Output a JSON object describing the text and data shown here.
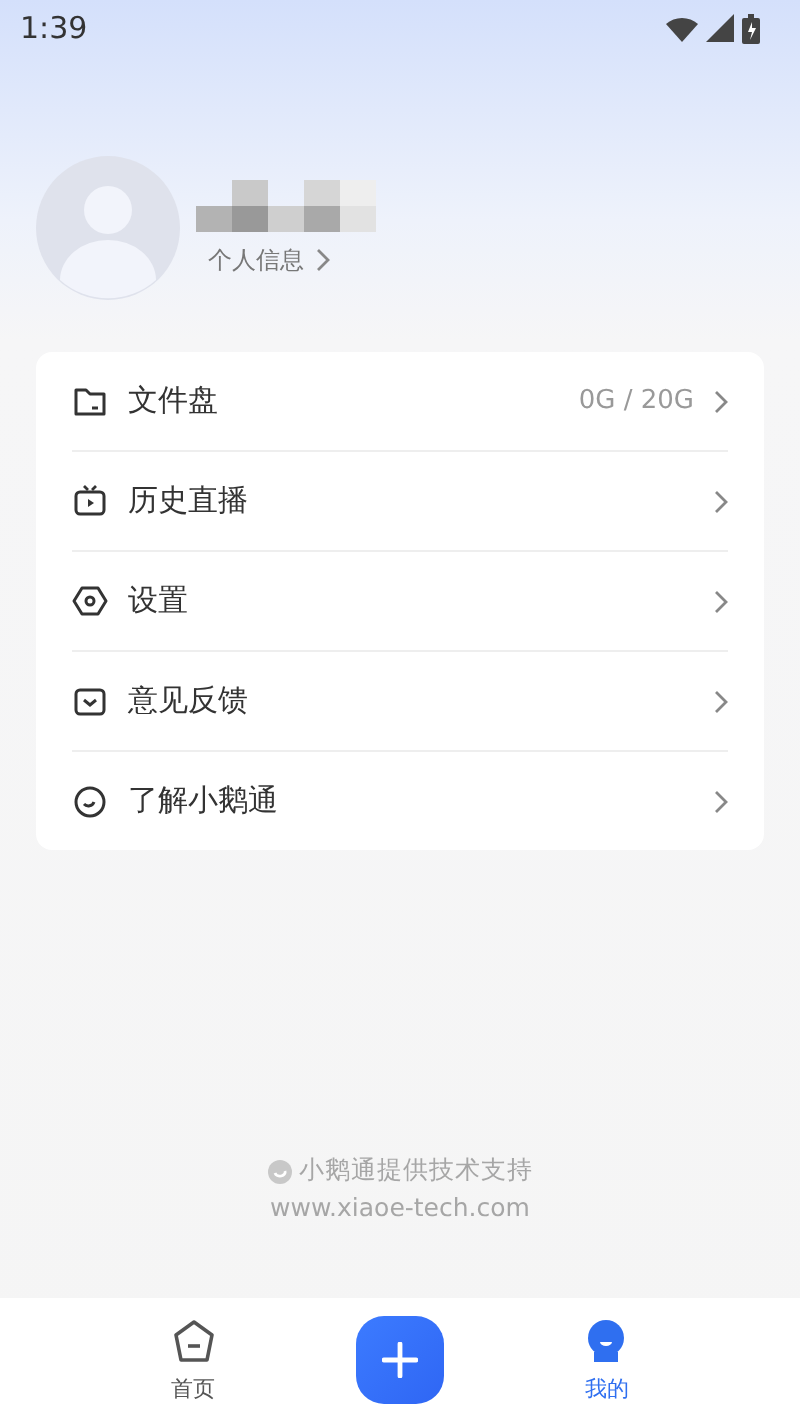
{
  "status_bar": {
    "time": "1:39"
  },
  "profile": {
    "link": "个人信息"
  },
  "menu": [
    {
      "label": "文件盘",
      "value": "0G / 20G"
    },
    {
      "label": "历史直播"
    },
    {
      "label": "设置"
    },
    {
      "label": "意见反馈"
    },
    {
      "label": "了解小鹅通"
    }
  ],
  "footer": {
    "credit": "小鹅通提供技术支持",
    "url": "www.xiaoe-tech.com"
  },
  "tabs": [
    {
      "kind": "tab",
      "label": "首页",
      "selected": false
    },
    {
      "kind": "add",
      "selected": false
    },
    {
      "kind": "tab",
      "label": "我的",
      "selected": true
    }
  ]
}
